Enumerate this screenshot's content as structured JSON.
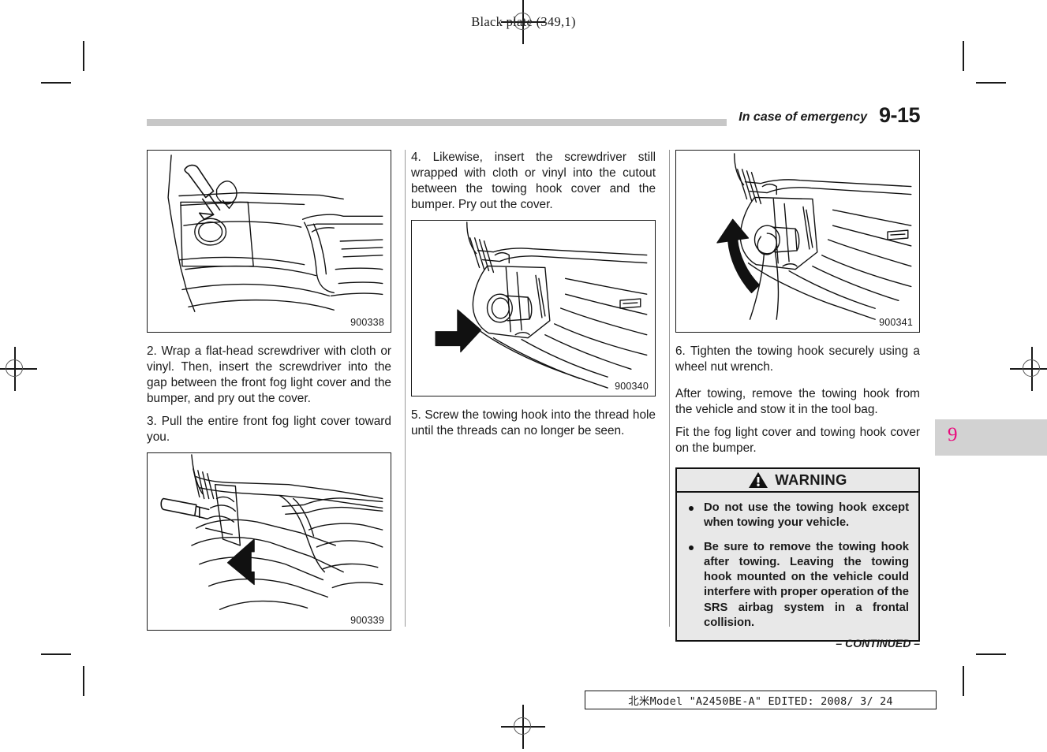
{
  "header": {
    "plate_note": "Black plate (349,1)"
  },
  "title_bar": {
    "chapter": "In case of emergency",
    "page_number": "9-15"
  },
  "thumb_tab": {
    "chapter_number": "9",
    "color": "#ea0a7d",
    "background": "#d2d2d2"
  },
  "columns": {
    "left": {
      "figure_top_id": "900338",
      "paragraphs": [
        "2.   Wrap a flat-head screwdriver with cloth or vinyl. Then, insert the screwdriver into the gap between the front fog light cover and the bumper, and pry out the cover.",
        "3.  Pull the entire front fog light cover toward you."
      ],
      "figure_bottom_id": "900339"
    },
    "middle": {
      "paragraph_top": "4.  Likewise, insert the screwdriver still wrapped with cloth or vinyl into the cutout between the towing hook cover and the bumper. Pry out the cover.",
      "figure_id": "900340",
      "paragraph_bottom": "5.   Screw the towing hook into the thread hole until the threads can no longer be seen."
    },
    "right": {
      "figure_id": "900341",
      "paragraphs": [
        "6.  Tighten the towing hook securely using a wheel nut wrench.",
        "After towing, remove the towing hook from the vehicle and stow it in the tool bag.",
        "Fit the fog light cover and towing hook cover on the bumper."
      ],
      "warning": {
        "heading": "WARNING",
        "bullets": [
          "Do not use the towing hook except when towing your vehicle.",
          "Be sure to remove the towing hook after towing. Leaving the towing hook mounted on the vehicle could interfere with proper operation of the SRS airbag system in a frontal collision."
        ]
      }
    }
  },
  "continued_note": "– CONTINUED –",
  "footer": {
    "plate_text": "北米Model \"A2450BE-A\"  EDITED:  2008/ 3/ 24"
  }
}
